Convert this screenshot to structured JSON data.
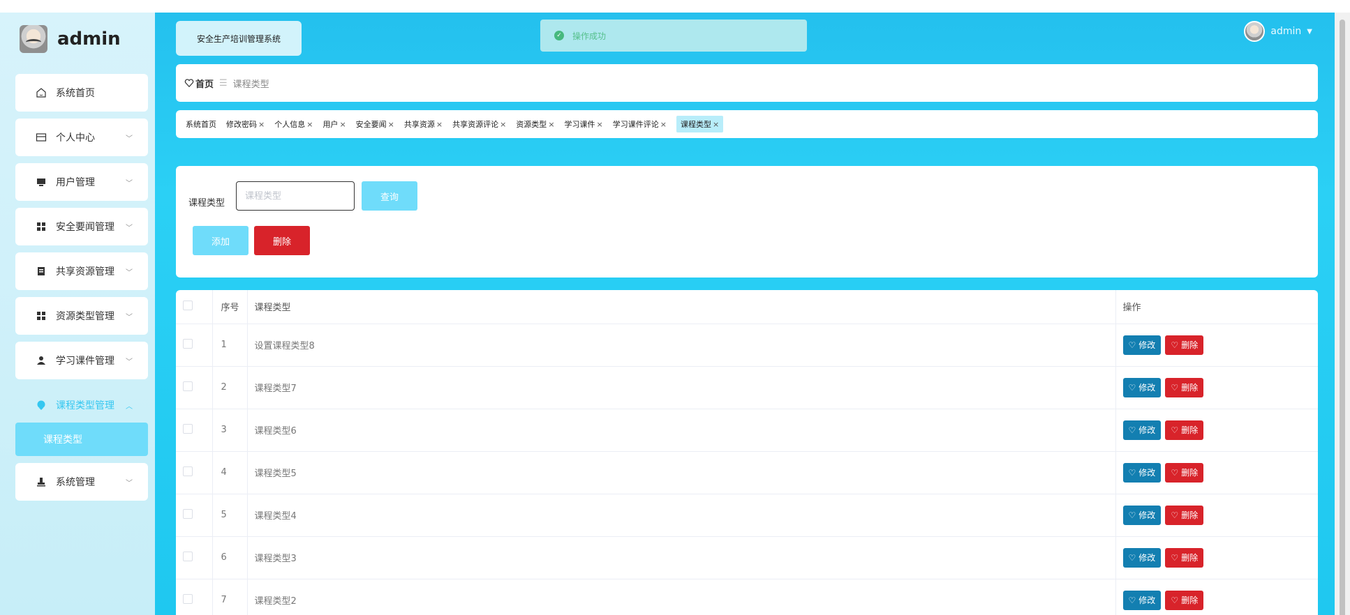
{
  "sidebar": {
    "brand": "admin",
    "menu": [
      {
        "label": "系统首页",
        "icon": "home-icon"
      },
      {
        "label": "个人中心",
        "icon": "card-icon"
      },
      {
        "label": "用户管理",
        "icon": "monitor-icon"
      },
      {
        "label": "安全要闻管理",
        "icon": "grid-icon"
      },
      {
        "label": "共享资源管理",
        "icon": "clipboard-icon"
      },
      {
        "label": "资源类型管理",
        "icon": "grid-icon"
      },
      {
        "label": "学习课件管理",
        "icon": "person-icon"
      },
      {
        "label": "课程类型管理",
        "icon": "location-icon"
      },
      {
        "label": "系统管理",
        "icon": "stamp-icon"
      }
    ],
    "active_sub": "课程类型"
  },
  "header": {
    "system_title": "安全生产培训管理系统",
    "toast": "操作成功",
    "user": "admin"
  },
  "breadcrumb": {
    "home": "首页",
    "current": "课程类型"
  },
  "tags": [
    {
      "label": "系统首页",
      "closable": false
    },
    {
      "label": "修改密码",
      "closable": true
    },
    {
      "label": "个人信息",
      "closable": true
    },
    {
      "label": "用户",
      "closable": true
    },
    {
      "label": "安全要闻",
      "closable": true
    },
    {
      "label": "共享资源",
      "closable": true
    },
    {
      "label": "共享资源评论",
      "closable": true
    },
    {
      "label": "资源类型",
      "closable": true
    },
    {
      "label": "学习课件",
      "closable": true
    },
    {
      "label": "学习课件评论",
      "closable": true
    },
    {
      "label": "课程类型",
      "closable": true
    }
  ],
  "search": {
    "label": "课程类型",
    "placeholder": "课程类型",
    "query_label": "查询",
    "add_label": "添加",
    "delete_label": "删除"
  },
  "table": {
    "headers": {
      "index": "序号",
      "name": "课程类型",
      "ops": "操作"
    },
    "rows": [
      {
        "index": "1",
        "name": "设置课程类型8"
      },
      {
        "index": "2",
        "name": "课程类型7"
      },
      {
        "index": "3",
        "name": "课程类型6"
      },
      {
        "index": "4",
        "name": "课程类型5"
      },
      {
        "index": "5",
        "name": "课程类型4"
      },
      {
        "index": "6",
        "name": "课程类型3"
      },
      {
        "index": "7",
        "name": "课程类型2"
      }
    ],
    "edit_label": "修改",
    "delete_label": "删除"
  },
  "colors": {
    "accent": "#6fdcfa",
    "danger": "#d8232a",
    "edit": "#137fb1",
    "header_bg": "#24c0ee"
  }
}
